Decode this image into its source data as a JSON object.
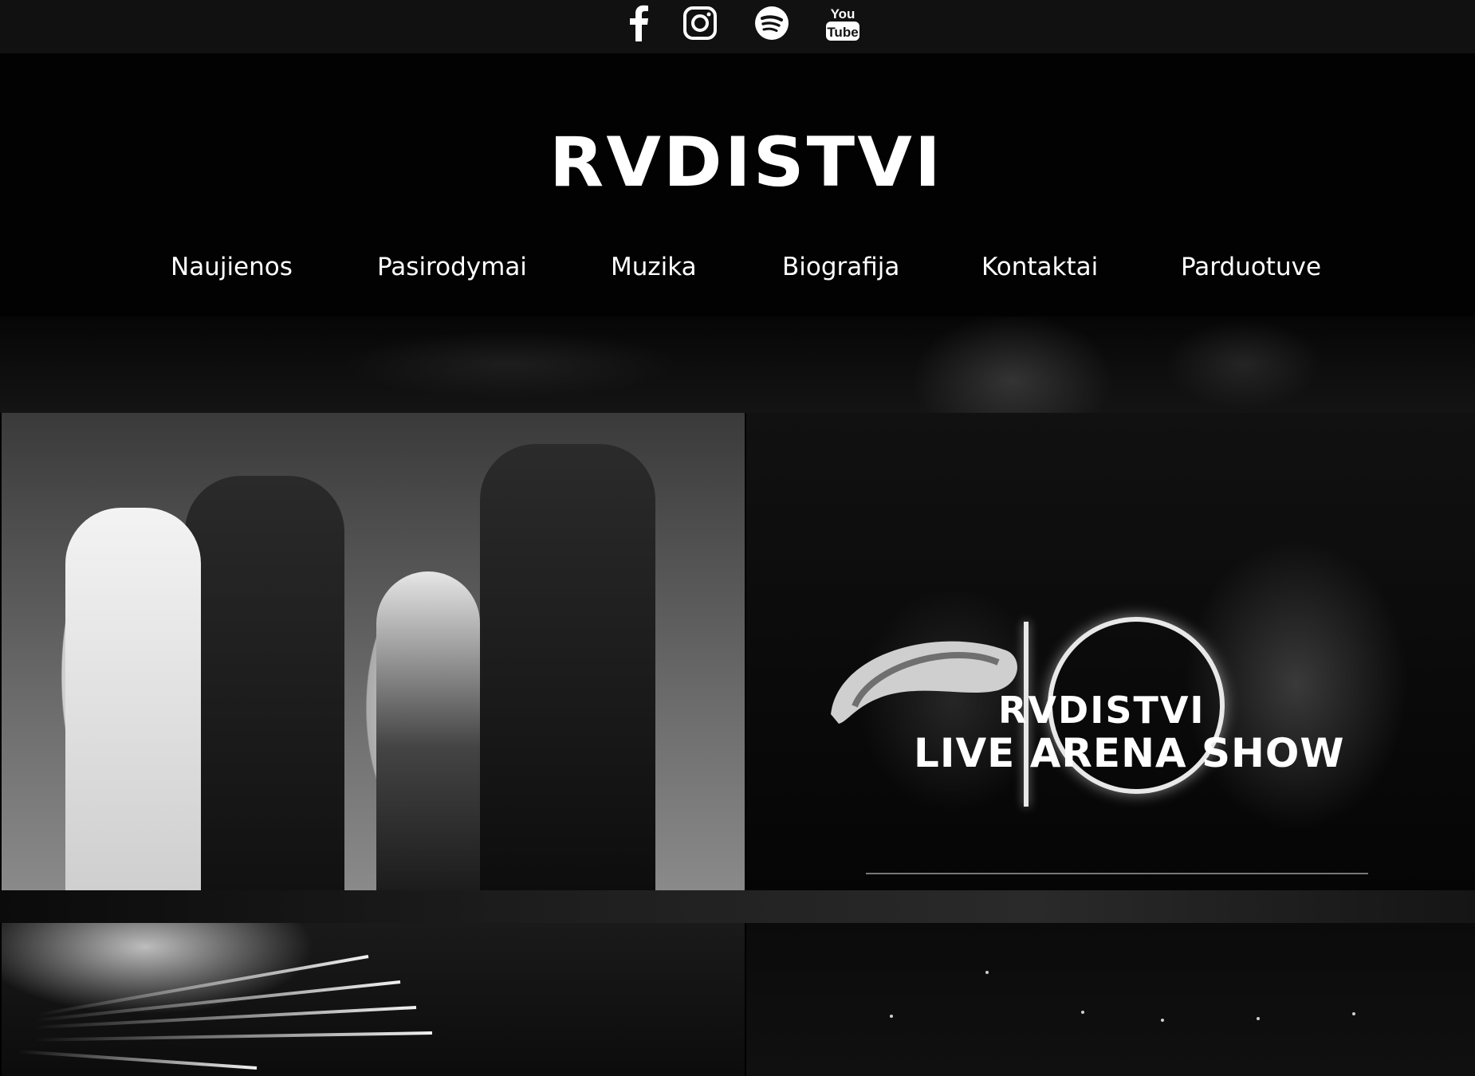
{
  "social": [
    {
      "name": "facebook-icon",
      "label": "f"
    },
    {
      "name": "instagram-icon",
      "label": ""
    },
    {
      "name": "spotify-icon",
      "label": ""
    },
    {
      "name": "youtube-icon",
      "label_top": "You",
      "label_bottom": "Tube"
    }
  ],
  "brand": {
    "logo": "RVDISTVI"
  },
  "nav": {
    "items": [
      "Naujienos",
      "Pasirodymai",
      "Muzika",
      "Biografija",
      "Kontaktai",
      "Parduotuve"
    ]
  },
  "tiles": {
    "show": {
      "logo": "RVDISTVI",
      "title": "LIVE ARENA SHOW"
    }
  },
  "colors": {
    "background": "#000000",
    "social_bar": "#111111",
    "text": "#ffffff"
  }
}
